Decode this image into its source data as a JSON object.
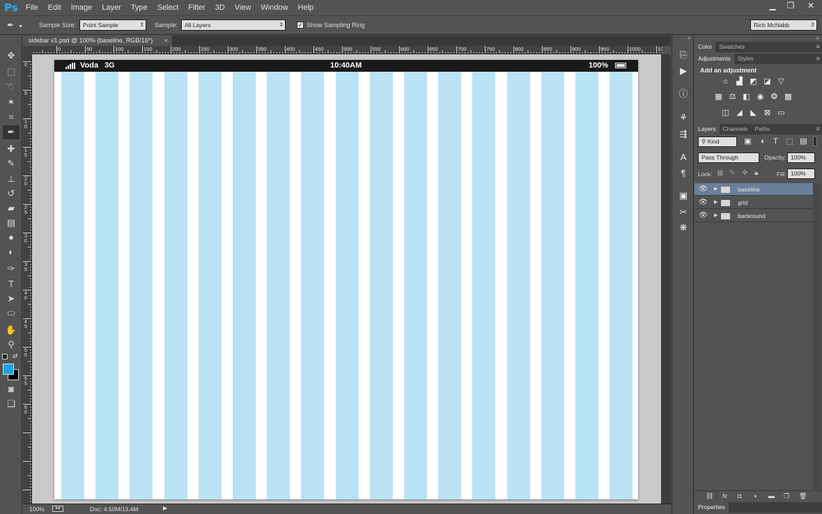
{
  "app": {
    "logo": "Ps"
  },
  "menu": [
    "File",
    "Edit",
    "Image",
    "Layer",
    "Type",
    "Select",
    "Filter",
    "3D",
    "View",
    "Window",
    "Help"
  ],
  "window_controls": {
    "minimize": "▁",
    "restore": "❐",
    "close": "✕"
  },
  "options": {
    "sample_size_label": "Sample Size:",
    "sample_size_value": "Point Sample",
    "sample_label": "Sample:",
    "sample_value": "All Layers",
    "show_ring_label": "Show Sampling Ring",
    "show_ring_checked": "✓",
    "workspace": "Rich McNabb"
  },
  "document": {
    "tab_title": "sidebar v1.psd @ 100% (baseline, RGB/16*)",
    "tab_close": "×",
    "zoom": "100%",
    "doc_info": "Doc: 4.50M/13.4M"
  },
  "ruler": {
    "h_labels": [
      "0",
      "50",
      "100",
      "150",
      "200",
      "250",
      "300",
      "350",
      "400",
      "450",
      "500",
      "550",
      "600",
      "650",
      "700",
      "750",
      "800",
      "850",
      "900",
      "950",
      "1000",
      "10"
    ],
    "v_labels": [
      "0",
      "5",
      "10",
      "15",
      "20",
      "25",
      "30",
      "35",
      "40",
      "45",
      "50",
      "55",
      "60"
    ]
  },
  "mockup": {
    "carrier": "Voda",
    "network": "3G",
    "time": "10:40AM",
    "battery": "100%",
    "column_color": "#b9e3f5"
  },
  "panels": {
    "color_tabs": [
      "Color",
      "Swatches"
    ],
    "adjust_tabs": [
      "Adjustments",
      "Styles"
    ],
    "adjust_heading": "Add an adjustment",
    "layer_tabs": [
      "Layers",
      "Channels",
      "Paths"
    ],
    "filter_kind": "Kind",
    "blend_mode": "Pass Through",
    "opacity_label": "Opacity:",
    "opacity_value": "100%",
    "lock_label": "Lock:",
    "fill_label": "Fill:",
    "fill_value": "100%",
    "layers": [
      {
        "name": "baseline",
        "selected": true
      },
      {
        "name": "grid",
        "selected": false
      },
      {
        "name": "backround",
        "selected": false
      }
    ],
    "properties_tab": "Properties"
  },
  "colors": {
    "accent_foreground": "#1da1e6",
    "selected_layer": "#6a7f99"
  }
}
